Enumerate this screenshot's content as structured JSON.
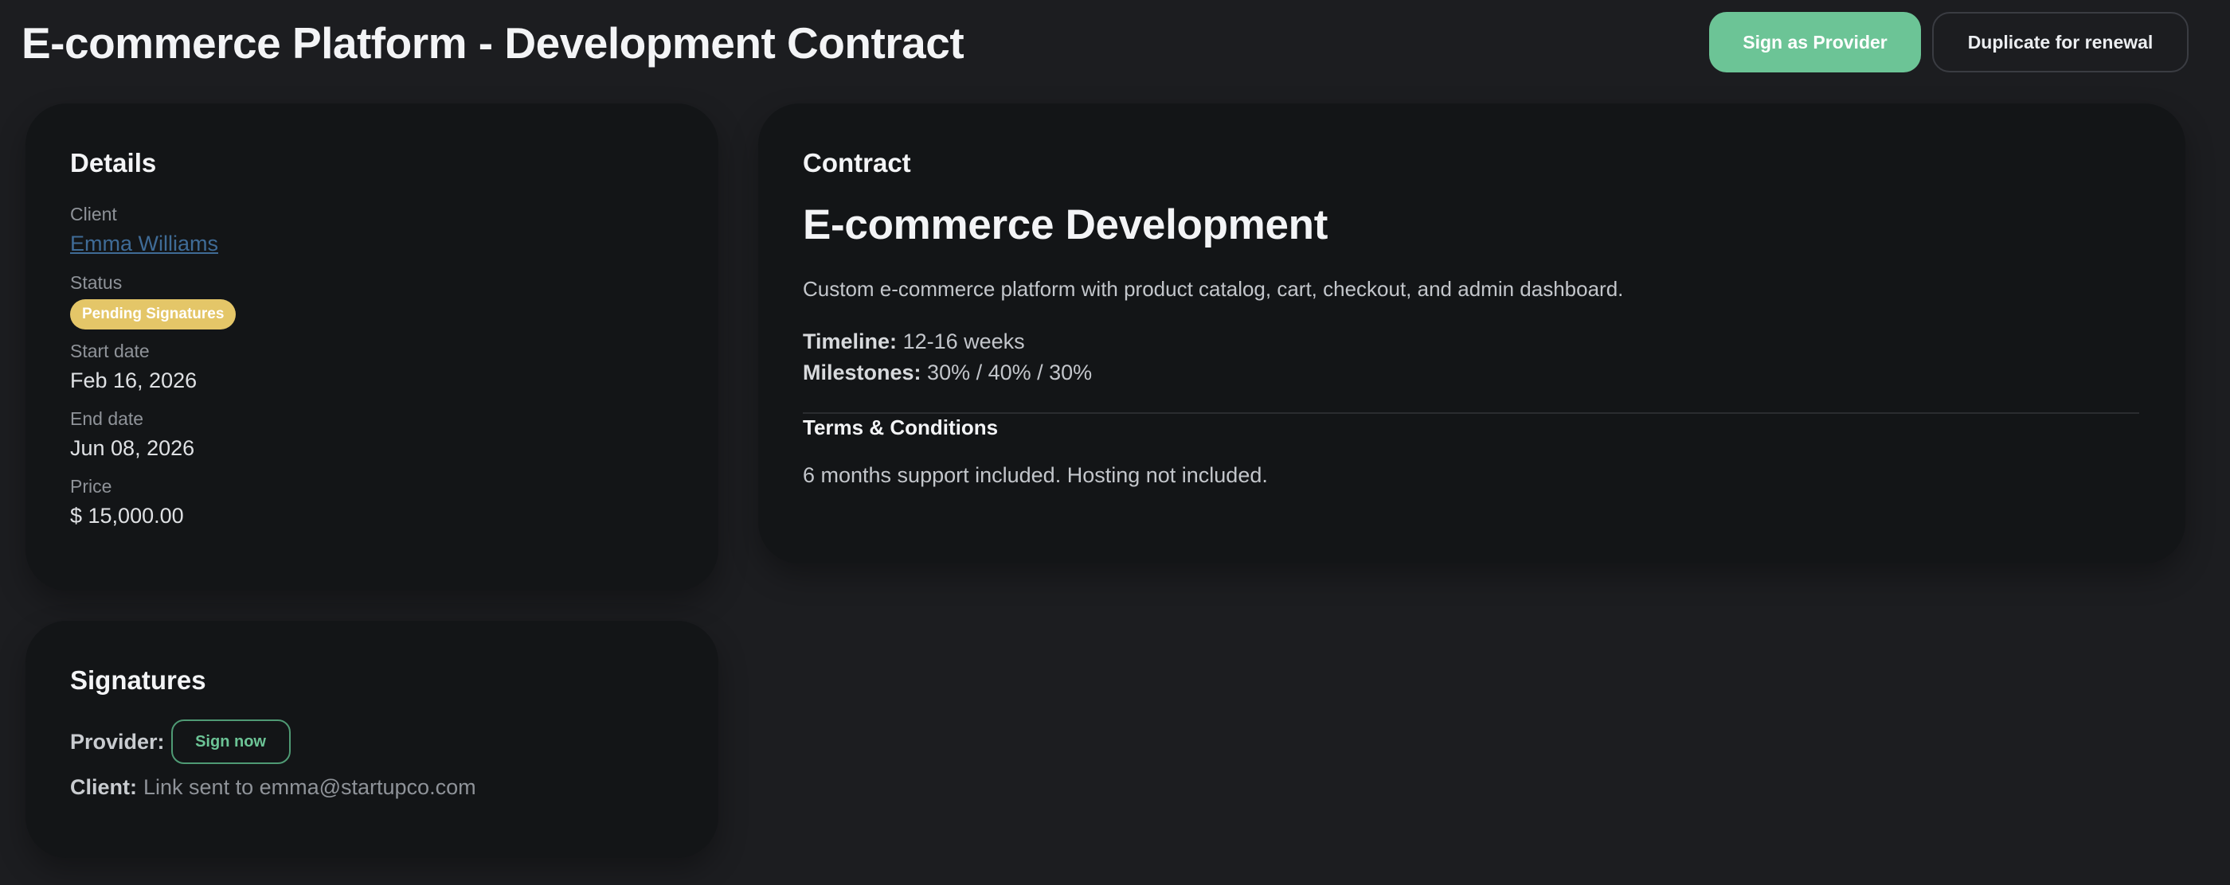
{
  "header": {
    "title": "E-commerce Platform - Development Contract",
    "sign_provider_label": "Sign as Provider",
    "duplicate_label": "Duplicate for renewal"
  },
  "details": {
    "heading": "Details",
    "client_label": "Client",
    "client_name": "Emma Williams",
    "status_label": "Status",
    "status_value": "Pending Signatures",
    "start_label": "Start date",
    "start_value": "Feb 16, 2026",
    "end_label": "End date",
    "end_value": "Jun 08, 2026",
    "price_label": "Price",
    "price_value": "$ 15,000.00"
  },
  "contract": {
    "heading": "Contract",
    "title": "E-commerce Development",
    "description": "Custom e-commerce platform with product catalog, cart, checkout, and admin dashboard.",
    "timeline_label": "Timeline:",
    "timeline_value": "12-16 weeks",
    "milestones_label": "Milestones:",
    "milestones_value": "30% / 40% / 30%",
    "terms_heading": "Terms & Conditions",
    "terms_text": "6 months support included. Hosting not included."
  },
  "signatures": {
    "heading": "Signatures",
    "provider_label": "Provider:",
    "sign_now_label": "Sign now",
    "client_label": "Client:",
    "client_status": "Link sent to emma@startupco.com"
  },
  "colors": {
    "background": "#1c1d20",
    "card": "#131517",
    "accent_green": "#6cc496",
    "status_badge": "#e4c668",
    "link": "#3f6b96"
  }
}
